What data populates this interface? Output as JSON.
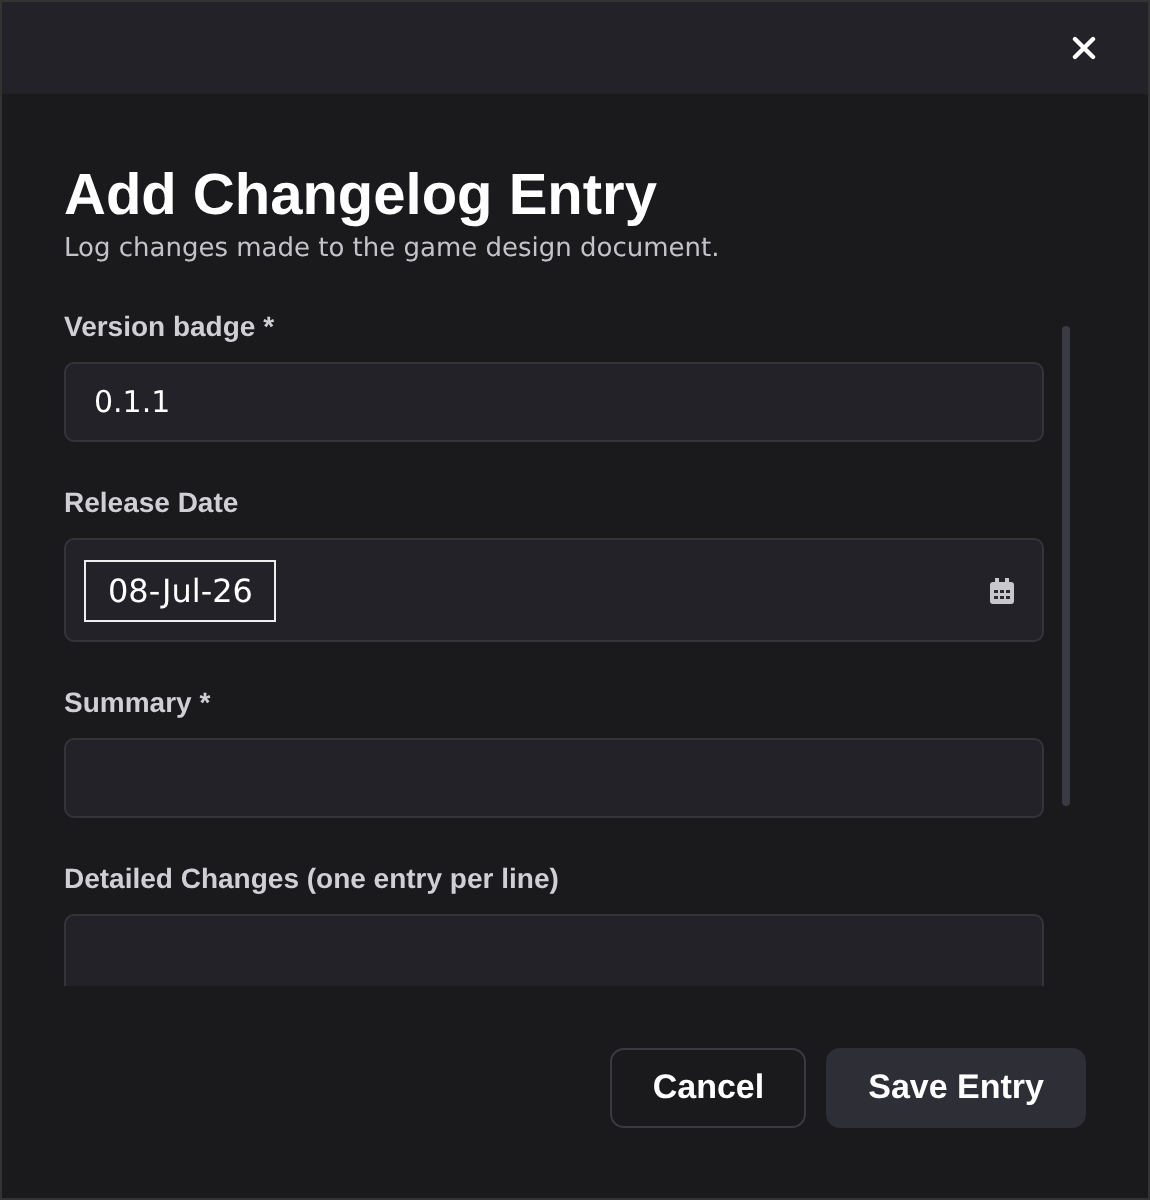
{
  "dialog": {
    "title": "Add Changelog Entry",
    "subtitle": "Log changes made to the game design document."
  },
  "fields": [
    {
      "kind": "text",
      "label": "Version badge *",
      "value": "0.1.1"
    },
    {
      "kind": "date",
      "label": "Release Date",
      "value": "08-Jul-26"
    },
    {
      "kind": "text",
      "label": "Summary *"
    },
    {
      "kind": "textarea",
      "label": "Detailed Changes (one entry per line)"
    }
  ],
  "buttons": [
    {
      "label": "Cancel",
      "kind": "secondary"
    },
    {
      "label": "Save Entry",
      "kind": "primary"
    }
  ]
}
